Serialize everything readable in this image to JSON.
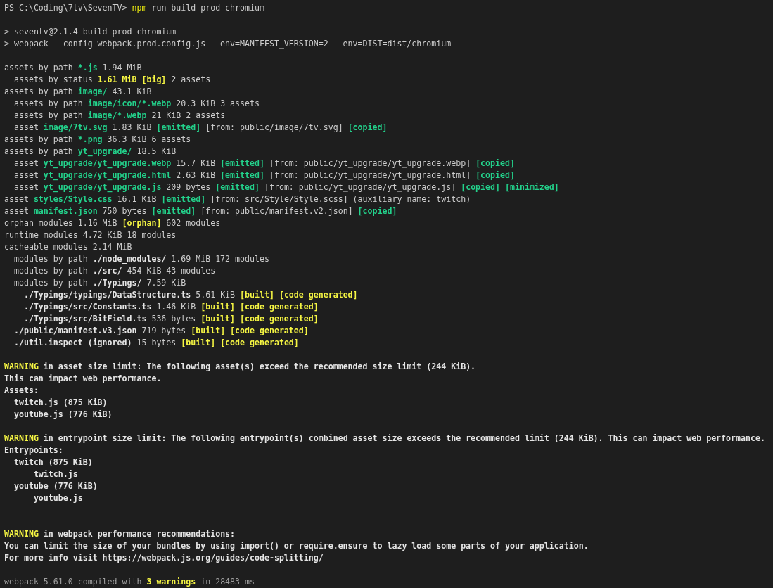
{
  "terminal": {
    "lines": [
      {
        "segments": [
          {
            "text": "PS C:\\Coding\\7tv\\SevenTV> "
          },
          {
            "text": "npm",
            "kind": "yellow"
          },
          {
            "text": " run build-prod-chromium"
          }
        ]
      },
      {
        "kind": "blank"
      },
      {
        "segments": [
          {
            "text": "> seventv@2.1.4 build-prod-chromium"
          }
        ]
      },
      {
        "segments": [
          {
            "text": "> webpack --config webpack.prod.config.js --env=MANIFEST_VERSION=2 --env=DIST=dist/chromium"
          }
        ]
      },
      {
        "kind": "blank"
      },
      {
        "segments": [
          {
            "text": "assets by path "
          },
          {
            "text": "*.js",
            "kind": "green"
          },
          {
            "text": " 1.94 MiB"
          }
        ]
      },
      {
        "segments": [
          {
            "text": "  assets by status "
          },
          {
            "text": "1.61 MiB [big]",
            "kind": "bold-yellow"
          },
          {
            "text": " 2 assets"
          }
        ]
      },
      {
        "segments": [
          {
            "text": "assets by path "
          },
          {
            "text": "image/",
            "kind": "green"
          },
          {
            "text": " 43.1 KiB"
          }
        ]
      },
      {
        "segments": [
          {
            "text": "  assets by path "
          },
          {
            "text": "image/icon/*.webp",
            "kind": "green"
          },
          {
            "text": " 20.3 KiB 3 assets"
          }
        ]
      },
      {
        "segments": [
          {
            "text": "  assets by path "
          },
          {
            "text": "image/*.webp",
            "kind": "green"
          },
          {
            "text": " 21 KiB 2 assets"
          }
        ]
      },
      {
        "segments": [
          {
            "text": "  asset "
          },
          {
            "text": "image/7tv.svg",
            "kind": "green"
          },
          {
            "text": " 1.83 KiB "
          },
          {
            "text": "[emitted]",
            "kind": "green"
          },
          {
            "text": " [from: public/image/7tv.svg] "
          },
          {
            "text": "[copied]",
            "kind": "green"
          }
        ]
      },
      {
        "segments": [
          {
            "text": "assets by path "
          },
          {
            "text": "*.png",
            "kind": "green"
          },
          {
            "text": " 36.3 KiB 6 assets"
          }
        ]
      },
      {
        "segments": [
          {
            "text": "assets by path "
          },
          {
            "text": "yt_upgrade/",
            "kind": "green"
          },
          {
            "text": " 18.5 KiB"
          }
        ]
      },
      {
        "segments": [
          {
            "text": "  asset "
          },
          {
            "text": "yt_upgrade/yt_upgrade.webp",
            "kind": "green"
          },
          {
            "text": " 15.7 KiB "
          },
          {
            "text": "[emitted]",
            "kind": "green"
          },
          {
            "text": " [from: public/yt_upgrade/yt_upgrade.webp] "
          },
          {
            "text": "[copied]",
            "kind": "green"
          }
        ]
      },
      {
        "segments": [
          {
            "text": "  asset "
          },
          {
            "text": "yt_upgrade/yt_upgrade.html",
            "kind": "green"
          },
          {
            "text": " 2.63 KiB "
          },
          {
            "text": "[emitted]",
            "kind": "green"
          },
          {
            "text": " [from: public/yt_upgrade/yt_upgrade.html] "
          },
          {
            "text": "[copied]",
            "kind": "green"
          }
        ]
      },
      {
        "segments": [
          {
            "text": "  asset "
          },
          {
            "text": "yt_upgrade/yt_upgrade.js",
            "kind": "green"
          },
          {
            "text": " 209 bytes "
          },
          {
            "text": "[emitted]",
            "kind": "green"
          },
          {
            "text": " [from: public/yt_upgrade/yt_upgrade.js] "
          },
          {
            "text": "[copied] [minimized]",
            "kind": "green"
          }
        ]
      },
      {
        "segments": [
          {
            "text": "asset "
          },
          {
            "text": "styles/Style.css",
            "kind": "green"
          },
          {
            "text": " 16.1 KiB "
          },
          {
            "text": "[emitted]",
            "kind": "green"
          },
          {
            "text": " [from: src/Style/Style.scss] (auxiliary name: twitch)"
          }
        ]
      },
      {
        "segments": [
          {
            "text": "asset "
          },
          {
            "text": "manifest.json",
            "kind": "green"
          },
          {
            "text": " 750 bytes "
          },
          {
            "text": "[emitted]",
            "kind": "green"
          },
          {
            "text": " [from: public/manifest.v2.json] "
          },
          {
            "text": "[copied]",
            "kind": "green"
          }
        ]
      },
      {
        "segments": [
          {
            "text": "orphan modules 1.16 MiB "
          },
          {
            "text": "[orphan]",
            "kind": "bold-yellow"
          },
          {
            "text": " 602 modules"
          }
        ]
      },
      {
        "segments": [
          {
            "text": "runtime modules 4.72 KiB 18 modules"
          }
        ]
      },
      {
        "segments": [
          {
            "text": "cacheable modules 2.14 MiB"
          }
        ]
      },
      {
        "segments": [
          {
            "text": "  modules by path "
          },
          {
            "text": "./node_modules/",
            "kind": "bold"
          },
          {
            "text": " 1.69 MiB 172 modules"
          }
        ]
      },
      {
        "segments": [
          {
            "text": "  modules by path "
          },
          {
            "text": "./src/",
            "kind": "bold"
          },
          {
            "text": " 454 KiB 43 modules"
          }
        ]
      },
      {
        "segments": [
          {
            "text": "  modules by path "
          },
          {
            "text": "./Typings/",
            "kind": "bold"
          },
          {
            "text": " 7.59 KiB"
          }
        ]
      },
      {
        "segments": [
          {
            "text": "    ./Typings/typings/DataStructure.ts",
            "kind": "bold"
          },
          {
            "text": " 5.61 KiB "
          },
          {
            "text": "[built] [code generated]",
            "kind": "bold-yellow"
          }
        ]
      },
      {
        "segments": [
          {
            "text": "    ./Typings/src/Constants.ts",
            "kind": "bold"
          },
          {
            "text": " 1.46 KiB "
          },
          {
            "text": "[built] [code generated]",
            "kind": "bold-yellow"
          }
        ]
      },
      {
        "segments": [
          {
            "text": "    ./Typings/src/BitField.ts",
            "kind": "bold"
          },
          {
            "text": " 536 bytes "
          },
          {
            "text": "[built] [code generated]",
            "kind": "bold-yellow"
          }
        ]
      },
      {
        "segments": [
          {
            "text": "  ./public/manifest.v3.json",
            "kind": "bold"
          },
          {
            "text": " 719 bytes "
          },
          {
            "text": "[built] [code generated]",
            "kind": "bold-yellow"
          }
        ]
      },
      {
        "segments": [
          {
            "text": "  ./util.inspect (ignored)",
            "kind": "bold"
          },
          {
            "text": " 15 bytes "
          },
          {
            "text": "[built] [code generated]",
            "kind": "bold-yellow"
          }
        ]
      },
      {
        "kind": "blank"
      },
      {
        "segments": [
          {
            "text": "WARNING",
            "kind": "bold-yellow"
          },
          {
            "text": " in asset size limit: The following asset(s) exceed the recommended size limit (244 KiB).",
            "kind": "bold"
          }
        ]
      },
      {
        "segments": [
          {
            "text": "This can impact web performance.",
            "kind": "bold"
          }
        ]
      },
      {
        "segments": [
          {
            "text": "Assets:",
            "kind": "bold"
          }
        ]
      },
      {
        "segments": [
          {
            "text": "  twitch.js (875 KiB)",
            "kind": "bold"
          }
        ]
      },
      {
        "segments": [
          {
            "text": "  youtube.js (776 KiB)",
            "kind": "bold"
          }
        ]
      },
      {
        "kind": "blank"
      },
      {
        "segments": [
          {
            "text": "WARNING",
            "kind": "bold-yellow"
          },
          {
            "text": " in entrypoint size limit: The following entrypoint(s) combined asset size exceeds the recommended limit (244 KiB). This can impact web performance.",
            "kind": "bold"
          }
        ]
      },
      {
        "segments": [
          {
            "text": "Entrypoints:",
            "kind": "bold"
          }
        ]
      },
      {
        "segments": [
          {
            "text": "  twitch (875 KiB)",
            "kind": "bold"
          }
        ]
      },
      {
        "segments": [
          {
            "text": "      twitch.js",
            "kind": "bold"
          }
        ]
      },
      {
        "segments": [
          {
            "text": "  youtube (776 KiB)",
            "kind": "bold"
          }
        ]
      },
      {
        "segments": [
          {
            "text": "      youtube.js",
            "kind": "bold"
          }
        ]
      },
      {
        "kind": "blank"
      },
      {
        "kind": "blank"
      },
      {
        "segments": [
          {
            "text": "WARNING",
            "kind": "bold-yellow"
          },
          {
            "text": " in webpack performance recommendations:",
            "kind": "bold"
          }
        ]
      },
      {
        "segments": [
          {
            "text": "You can limit the size of your bundles by using import() or require.ensure to lazy load some parts of your application.",
            "kind": "bold"
          }
        ]
      },
      {
        "segments": [
          {
            "text": "For more info visit https://webpack.js.org/guides/code-splitting/",
            "kind": "bold"
          }
        ]
      },
      {
        "kind": "blank"
      },
      {
        "segments": [
          {
            "text": "webpack 5.61.0 compiled with ",
            "kind": "dim"
          },
          {
            "text": "3 warnings",
            "kind": "bold-yellow"
          },
          {
            "text": " in 28483 ms",
            "kind": "dim"
          }
        ]
      }
    ]
  }
}
